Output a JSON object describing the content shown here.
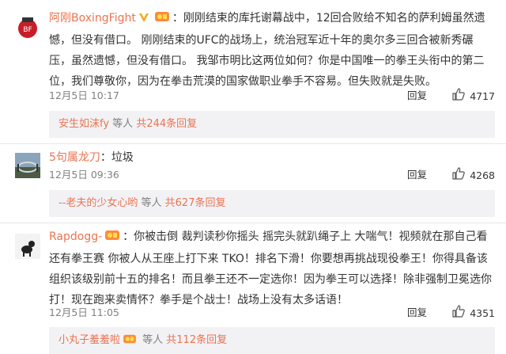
{
  "comments": [
    {
      "user": "阿刚BoxingFight",
      "verified_icon": "gold-v-icon",
      "level_icon": "vip-badge-icon",
      "text": "：刚刚结束的库托谢幕战中，12回合败给不知名的萨利姆虽然遗憾，但没有借口。 刚刚结束的UFC的战场上，统治冠军近十年的奥尔多三回合被新秀碾压，虽然遗憾，但没有借口。 我邹市明比这两位如何？你是中国唯一的拳王头衔中的第二位，我们尊敬你，因为在拳击荒漠的国家做职业拳手不容易。但失败就是失败。",
      "time": "12月5日 10:17",
      "reply_label": "回复",
      "likes": "4717",
      "sub_user": "安生如沫fy",
      "sub_rest_prefix": " 等人 ",
      "sub_count_link": "共244条回复"
    },
    {
      "user": "5句属龙刀",
      "text": "：垃圾",
      "time": "12月5日 09:36",
      "reply_label": "回复",
      "likes": "4268",
      "sub_user": "--老夫的少女心哟",
      "sub_rest_prefix": " 等人 ",
      "sub_count_link": "共627条回复"
    },
    {
      "user": "Rapdogg-",
      "level_icon": "vip-badge-icon",
      "text": "：你被击倒 裁判读秒你摇头 摇完头就趴绳子上 大喘气！视频就在那自己看 还有拳王赛 你被人从王座上打下来 TKO！排名下滑！你要想再挑战现役拳王！你得具备该组织该级别前十五的排名！而且拳王还不一定选你！因为拳王可以选择！除非强制卫冕选你打！现在跑来卖情怀？拳手是个战士！战场上没有太多话语！",
      "time": "12月5日 11:05",
      "reply_label": "回复",
      "likes": "4351",
      "sub_user": "小丸子羞羞啦",
      "sub_rest_prefix": " 等人 ",
      "sub_count_link": "共112条回复",
      "sub_badge_icon": "vip-badge-icon"
    }
  ],
  "colors": {
    "link": "#eb7350",
    "meta": "#808080",
    "sub_bg": "#f2f2f5"
  }
}
